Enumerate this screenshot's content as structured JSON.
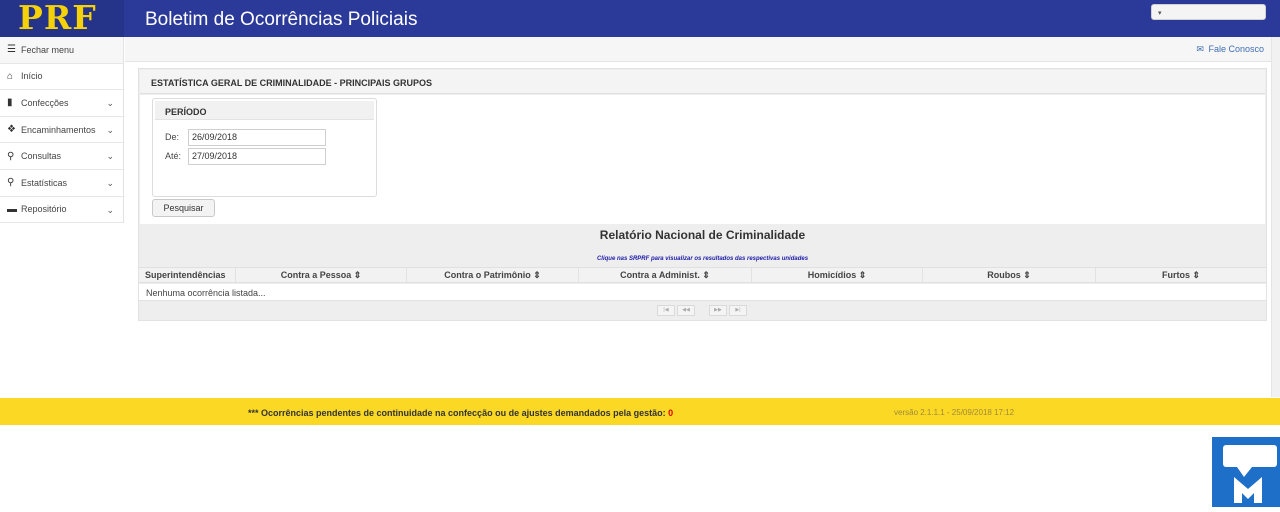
{
  "header": {
    "logo_text": "PRF",
    "app_title": "Boletim de Ocorrências Policiais",
    "user_menu": {
      "caret": "▾",
      "label": ""
    }
  },
  "sidebar": {
    "items": [
      {
        "label": "Fechar menu",
        "icon": "hamburger-icon",
        "glyph": "☰"
      },
      {
        "label": "Início",
        "icon": "home-icon",
        "glyph": "⌂"
      },
      {
        "label": "Confecções",
        "icon": "book-icon",
        "glyph": "▮"
      },
      {
        "label": "Encaminhamentos",
        "icon": "dropbox-icon",
        "glyph": "❖"
      },
      {
        "label": "Consultas",
        "icon": "search-icon",
        "glyph": "⚲"
      },
      {
        "label": "Estatísticas",
        "icon": "search-icon",
        "glyph": "⚲"
      },
      {
        "label": "Repositório",
        "icon": "archive-icon",
        "glyph": "▬"
      }
    ],
    "chevron": "⌄"
  },
  "subheader": {
    "contact_label": "Fale Conosco",
    "contact_glyph": "✉"
  },
  "panel": {
    "title": "ESTATÍSTICA GERAL DE CRIMINALIDADE - PRINCIPAIS GRUPOS",
    "period": {
      "title": "PERÍODO",
      "from_label": "De:",
      "from_value": "26/09/2018",
      "to_label": "Até:",
      "to_value": "27/09/2018"
    },
    "search_label": "Pesquisar",
    "report": {
      "title": "Relatório Nacional de Criminalidade",
      "note": "Clique nas SRPRF para visualizar os resultados das respectivas unidades",
      "columns": [
        "Superintendências",
        "Contra a Pessoa ⇕",
        "Contra o Patrimônio ⇕",
        "Contra a Administ. ⇕",
        "Homicídios ⇕",
        "Roubos ⇕",
        "Furtos ⇕"
      ],
      "empty_text": "Nenhuma ocorrência listada...",
      "pager": [
        "|◀",
        "◀◀",
        "▶▶",
        "▶|"
      ]
    }
  },
  "footer": {
    "message": "*** Ocorrências pendentes de continuidade na confecção ou de ajustes demandados pela gestão:",
    "count": "0",
    "version": "versão 2.1.1.1 - 25/09/2018 17:12"
  },
  "colors": {
    "brand_blue": "#2b3a99",
    "logo_yellow": "#f5d10a",
    "footer_yellow": "#fbd824",
    "chat_blue": "#1e6fc7"
  }
}
